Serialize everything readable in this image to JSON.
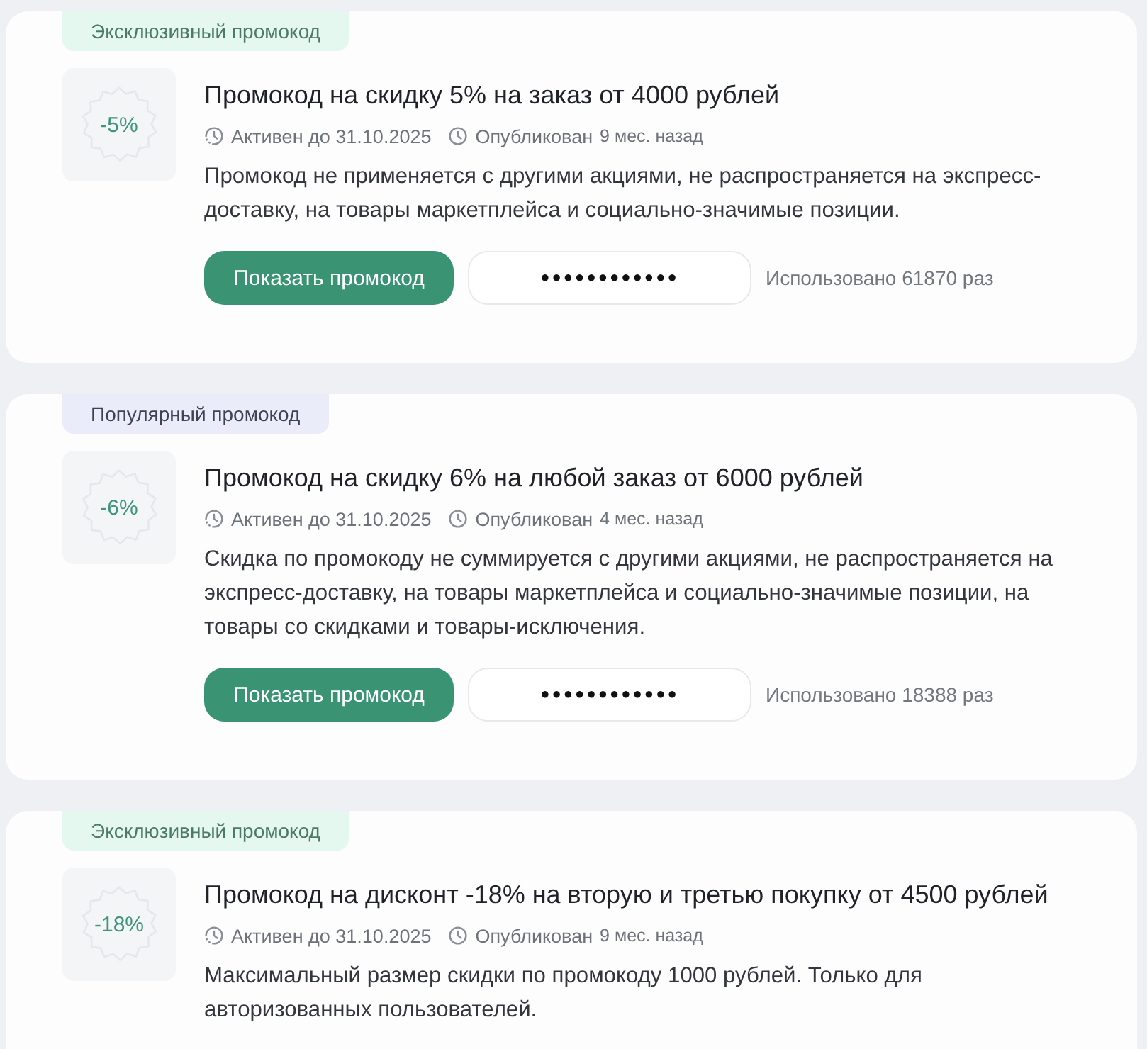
{
  "promos": [
    {
      "badge": {
        "kind": "exclusive",
        "label": "Эксклюзивный промокод"
      },
      "discount": "-5%",
      "title": "Промокод на скидку 5% на заказ от 4000 рублей",
      "active_until": "Активен до 31.10.2025",
      "published_label": "Опубликован",
      "published_ago": "9 мес. назад",
      "description": "Промокод не применяется с другими акциями, не распространяется на экспресс-доставку, на товары маркетплейса и социально-значимые позиции.",
      "show_button": "Показать промокод",
      "code_mask": "●●●●●●●●●●●●",
      "usage": "Использовано 61870 раз"
    },
    {
      "badge": {
        "kind": "popular",
        "label": "Популярный промокод"
      },
      "discount": "-6%",
      "title": "Промокод на скидку 6% на любой заказ от 6000 рублей",
      "active_until": "Активен до 31.10.2025",
      "published_label": "Опубликован",
      "published_ago": "4 мес. назад",
      "description": "Скидка по промокоду не суммируется с другими акциями, не распространяется на экспресс-доставку, на товары маркетплейса и социально-значимые позиции, на товары со скидками и товары-исключения.",
      "show_button": "Показать промокод",
      "code_mask": "●●●●●●●●●●●●",
      "usage": "Использовано 18388 раз"
    },
    {
      "badge": {
        "kind": "exclusive",
        "label": "Эксклюзивный промокод"
      },
      "discount": "-18%",
      "title": "Промокод на дисконт -18% на вторую и третью покупку от 4500 рублей",
      "active_until": "Активен до 31.10.2025",
      "published_label": "Опубликован",
      "published_ago": "9 мес. назад",
      "description": "Максимальный размер скидки по промокоду 1000 рублей. Только для авторизованных пользователей."
    }
  ]
}
